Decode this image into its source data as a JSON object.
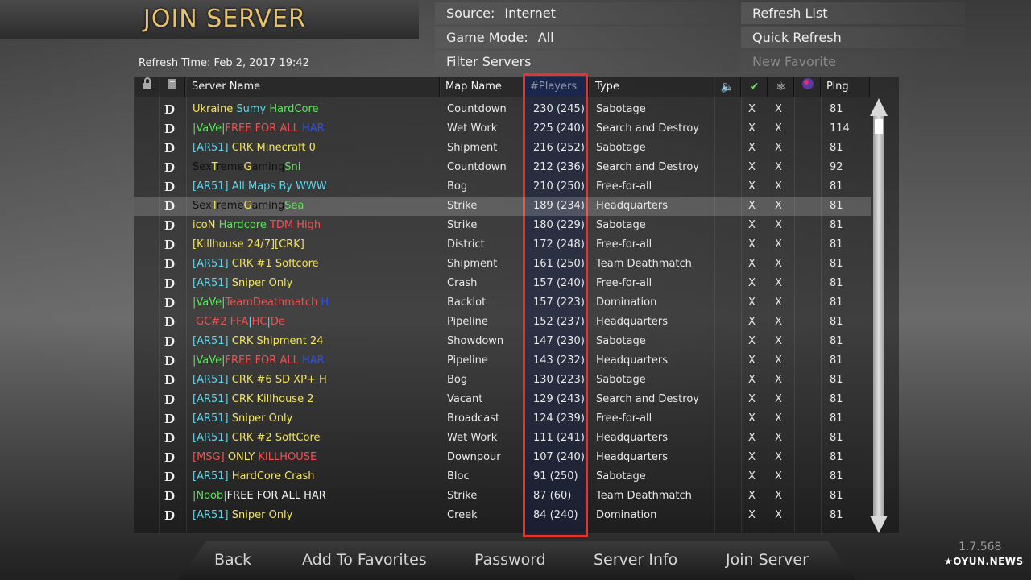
{
  "header": {
    "title": "JOIN SERVER",
    "refresh_time": "Refresh Time: Feb 2, 2017   19:42"
  },
  "controls": {
    "source_label": "Source:",
    "source_value": "Internet",
    "game_mode_label": "Game Mode:",
    "game_mode_value": "All",
    "filter_servers": "Filter Servers",
    "refresh_list": "Refresh List",
    "quick_refresh": "Quick Refresh",
    "new_favorite": "New Favorite"
  },
  "columns": {
    "server_name": "Server Name",
    "map_name": "Map Name",
    "players": "#Players",
    "type": "Type",
    "ping": "Ping"
  },
  "icons": {
    "lock": "lock-icon",
    "dedicated": "dedicated-icon",
    "voice": "speaker-icon",
    "pure": "check-icon",
    "mod": "atom-icon",
    "punkbuster": "orb-icon"
  },
  "colors": {
    "title": "#e8c26a",
    "highlight_border": "#e2362c",
    "selected_row": "#5a5a5a"
  },
  "rows": [
    {
      "d": "D",
      "name": [
        {
          "t": "Ukraine ",
          "c": "#f2e35a"
        },
        {
          "t": "Sumy ",
          "c": "#5cd6e8"
        },
        {
          "t": "HardCore",
          "c": "#5ee35a"
        }
      ],
      "map": "Countdown",
      "players": "230 (245)",
      "type": "Sabotage",
      "x1": "X",
      "x2": "X",
      "ping": "81"
    },
    {
      "d": "D",
      "name": [
        {
          "t": "|VaVe|",
          "c": "#5ee35a"
        },
        {
          "t": "FREE FOR ALL ",
          "c": "#f05050"
        },
        {
          "t": "HAR",
          "c": "#3050e0"
        }
      ],
      "map": "Wet Work",
      "players": "225 (240)",
      "type": "Search and Destroy",
      "x1": "X",
      "x2": "X",
      "ping": "114"
    },
    {
      "d": "D",
      "name": [
        {
          "t": "[AR51] ",
          "c": "#5cd6e8"
        },
        {
          "t": "CRK Minecraft 0",
          "c": "#f2e35a"
        }
      ],
      "map": "Shipment",
      "players": "216 (252)",
      "type": "Sabotage",
      "x1": "X",
      "x2": "X",
      "ping": "81"
    },
    {
      "d": "D",
      "name": [
        {
          "t": "Sex",
          "c": "#111111"
        },
        {
          "t": "T",
          "c": "#f2e35a"
        },
        {
          "t": "reme",
          "c": "#111111"
        },
        {
          "t": "G",
          "c": "#f2e35a"
        },
        {
          "t": "aming",
          "c": "#111111"
        },
        {
          "t": "Sni",
          "c": "#5ee35a"
        }
      ],
      "map": "Countdown",
      "players": "212 (236)",
      "type": "Search and Destroy",
      "x1": "X",
      "x2": "X",
      "ping": "92"
    },
    {
      "d": "D",
      "name": [
        {
          "t": "[AR51] All Maps By WWW",
          "c": "#5cd6e8"
        }
      ],
      "map": "Bog",
      "players": "210 (250)",
      "type": "Free-for-all",
      "x1": "X",
      "x2": "X",
      "ping": "81"
    },
    {
      "d": "D",
      "selected": true,
      "name": [
        {
          "t": "Sex",
          "c": "#111111"
        },
        {
          "t": "T",
          "c": "#f2e35a"
        },
        {
          "t": "reme",
          "c": "#111111"
        },
        {
          "t": "G",
          "c": "#f2e35a"
        },
        {
          "t": "aming",
          "c": "#111111"
        },
        {
          "t": "Sea",
          "c": "#5ee35a"
        }
      ],
      "map": "Strike",
      "players": "189 (234)",
      "type": "Headquarters",
      "x1": "X",
      "x2": "X",
      "ping": "81"
    },
    {
      "d": "D",
      "name": [
        {
          "t": "icoN ",
          "c": "#f2e35a"
        },
        {
          "t": "Hardcore ",
          "c": "#5ee35a"
        },
        {
          "t": "TDM High",
          "c": "#f05050"
        }
      ],
      "map": "Strike",
      "players": "180 (229)",
      "type": "Sabotage",
      "x1": "X",
      "x2": "X",
      "ping": "81"
    },
    {
      "d": "D",
      "name": [
        {
          "t": "[Killhouse 24/7][CRK]",
          "c": "#f2e35a"
        }
      ],
      "map": "District",
      "players": "172 (248)",
      "type": "Free-for-all",
      "x1": "X",
      "x2": "X",
      "ping": "81"
    },
    {
      "d": "D",
      "name": [
        {
          "t": "[AR51] ",
          "c": "#5cd6e8"
        },
        {
          "t": "CRK #1 Softcore",
          "c": "#f2e35a"
        }
      ],
      "map": "Shipment",
      "players": "161 (250)",
      "type": "Team Deathmatch",
      "x1": "X",
      "x2": "X",
      "ping": "81"
    },
    {
      "d": "D",
      "name": [
        {
          "t": "[AR51] ",
          "c": "#5cd6e8"
        },
        {
          "t": "Sniper Only",
          "c": "#f2e35a"
        }
      ],
      "map": "Crash",
      "players": "157 (240)",
      "type": "Free-for-all",
      "x1": "X",
      "x2": "X",
      "ping": "81"
    },
    {
      "d": "D",
      "name": [
        {
          "t": "|VaVe|",
          "c": "#5ee35a"
        },
        {
          "t": "TeamDeathmatch ",
          "c": "#f05050"
        },
        {
          "t": "H",
          "c": "#3050e0"
        }
      ],
      "map": "Backlot",
      "players": "157 (223)",
      "type": "Domination",
      "x1": "X",
      "x2": "X",
      "ping": "81"
    },
    {
      "d": "D",
      "name": [
        {
          "t": " GC#2 FFA",
          "c": "#f05050"
        },
        {
          "t": "|",
          "c": "#5cd6e8"
        },
        {
          "t": "HC",
          "c": "#f05050"
        },
        {
          "t": "|",
          "c": "#5cd6e8"
        },
        {
          "t": "De",
          "c": "#f05050"
        }
      ],
      "map": "Pipeline",
      "players": "152 (237)",
      "type": "Headquarters",
      "x1": "X",
      "x2": "X",
      "ping": "81"
    },
    {
      "d": "D",
      "name": [
        {
          "t": "[AR51] ",
          "c": "#5cd6e8"
        },
        {
          "t": "CRK Shipment 24",
          "c": "#f2e35a"
        }
      ],
      "map": "Showdown",
      "players": "147 (230)",
      "type": "Sabotage",
      "x1": "X",
      "x2": "X",
      "ping": "81"
    },
    {
      "d": "D",
      "name": [
        {
          "t": "|VaVe|",
          "c": "#5ee35a"
        },
        {
          "t": "FREE FOR ALL ",
          "c": "#f05050"
        },
        {
          "t": "HAR",
          "c": "#3050e0"
        }
      ],
      "map": "Pipeline",
      "players": "143 (232)",
      "type": "Headquarters",
      "x1": "X",
      "x2": "X",
      "ping": "81"
    },
    {
      "d": "D",
      "name": [
        {
          "t": "[AR51] ",
          "c": "#5cd6e8"
        },
        {
          "t": "CRK #6 SD XP+ H",
          "c": "#f2e35a"
        }
      ],
      "map": "Bog",
      "players": "130 (223)",
      "type": "Sabotage",
      "x1": "X",
      "x2": "X",
      "ping": "81"
    },
    {
      "d": "D",
      "name": [
        {
          "t": "[AR51] ",
          "c": "#5cd6e8"
        },
        {
          "t": "CRK Killhouse 2",
          "c": "#f2e35a"
        }
      ],
      "map": "Vacant",
      "players": "129 (243)",
      "type": "Search and Destroy",
      "x1": "X",
      "x2": "X",
      "ping": "81"
    },
    {
      "d": "D",
      "name": [
        {
          "t": "[AR51] ",
          "c": "#5cd6e8"
        },
        {
          "t": "Sniper Only",
          "c": "#f2e35a"
        }
      ],
      "map": "Broadcast",
      "players": "124 (239)",
      "type": "Free-for-all",
      "x1": "X",
      "x2": "X",
      "ping": "81"
    },
    {
      "d": "D",
      "name": [
        {
          "t": "[AR51] ",
          "c": "#5cd6e8"
        },
        {
          "t": "CRK #2 SoftCore",
          "c": "#f2e35a"
        }
      ],
      "map": "Wet Work",
      "players": "111 (241)",
      "type": "Headquarters",
      "x1": "X",
      "x2": "X",
      "ping": "81"
    },
    {
      "d": "D",
      "name": [
        {
          "t": "[MSG] ",
          "c": "#f05050"
        },
        {
          "t": "ONLY ",
          "c": "#f2e35a"
        },
        {
          "t": "KILLHOUSE",
          "c": "#f05050"
        }
      ],
      "map": "Downpour",
      "players": "107 (240)",
      "type": "Headquarters",
      "x1": "X",
      "x2": "X",
      "ping": "81"
    },
    {
      "d": "D",
      "name": [
        {
          "t": "[AR51] ",
          "c": "#5cd6e8"
        },
        {
          "t": "HardCore Crash",
          "c": "#f2e35a"
        }
      ],
      "map": "Bloc",
      "players": "91 (250)",
      "type": "Sabotage",
      "x1": "X",
      "x2": "X",
      "ping": "81"
    },
    {
      "d": "D",
      "name": [
        {
          "t": "|Noob|",
          "c": "#5ee35a"
        },
        {
          "t": "FREE FOR ALL HAR",
          "c": "#f2f2f2"
        }
      ],
      "map": "Strike",
      "players": "87 (60)",
      "type": "Team Deathmatch",
      "x1": "X",
      "x2": "X",
      "ping": "81"
    },
    {
      "d": "D",
      "name": [
        {
          "t": "[AR51] ",
          "c": "#5cd6e8"
        },
        {
          "t": "Sniper Only",
          "c": "#f2e35a"
        }
      ],
      "map": "Creek",
      "players": "84 (240)",
      "type": "Domination",
      "x1": "X",
      "x2": "X",
      "ping": "81"
    }
  ],
  "footer": {
    "back": "Back",
    "add_to_favorites": "Add To Favorites",
    "password": "Password",
    "server_info": "Server Info",
    "join_server": "Join Server"
  },
  "version": "1.7.568",
  "watermark": "★OYUN.NEWS"
}
